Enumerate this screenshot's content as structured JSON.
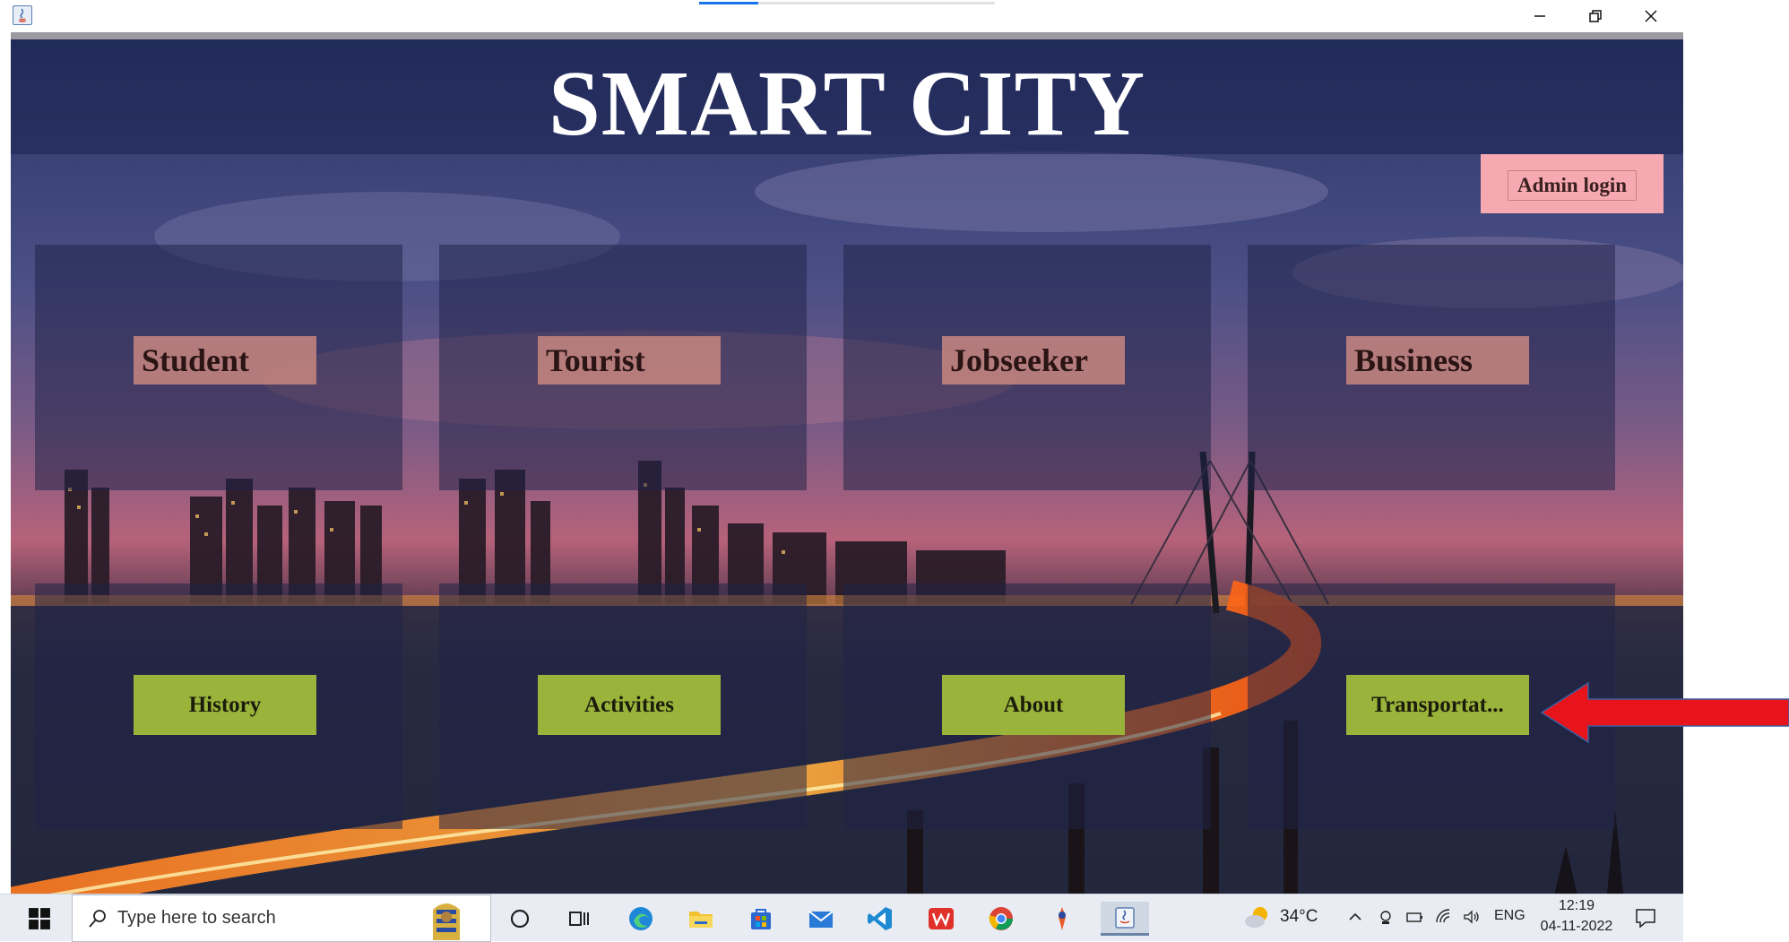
{
  "window": {
    "app_icon": "java-icon",
    "controls": [
      "minimize-icon",
      "restore-icon",
      "close-icon"
    ]
  },
  "app": {
    "title": "SMART CITY",
    "admin_login": "Admin login",
    "top_tiles": [
      {
        "label": "Student"
      },
      {
        "label": "Tourist"
      },
      {
        "label": "Jobseeker"
      },
      {
        "label": "Business"
      }
    ],
    "bottom_tiles": [
      {
        "label": "History"
      },
      {
        "label": "Activities"
      },
      {
        "label": "About"
      },
      {
        "label": "Transportat..."
      }
    ],
    "colors": {
      "top_button": "#c48480",
      "bottom_button": "#9ab33a",
      "admin_button": "#f6a9b0",
      "annotation_arrow": "#e8141c"
    }
  },
  "taskbar": {
    "search_placeholder": "Type here to search",
    "pinned_icons": [
      "cortana-icon",
      "task-view-icon",
      "edge-icon",
      "file-explorer-icon",
      "store-icon",
      "mail-icon",
      "vscode-icon",
      "wps-icon",
      "chrome-icon",
      "app-icon",
      "java-icon"
    ],
    "weather_temp": "34°C",
    "language": "ENG",
    "time": "12:19",
    "date": "04-11-2022"
  }
}
